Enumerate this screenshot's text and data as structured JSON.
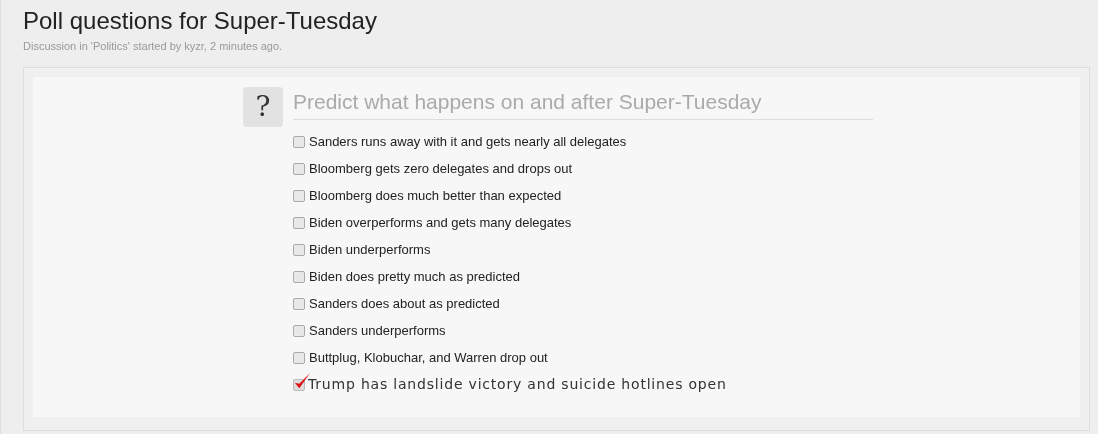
{
  "thread": {
    "title": "Poll questions for Super-Tuesday",
    "meta": "Discussion in 'Politics' started by kyzr, 2 minutes ago."
  },
  "poll": {
    "icon": "?",
    "question": "Predict what happens on and after Super-Tuesday",
    "options": [
      {
        "label": "Sanders runs away with it and gets nearly all delegates",
        "checked": false
      },
      {
        "label": "Bloomberg gets zero delegates and drops out",
        "checked": false
      },
      {
        "label": "Bloomberg does much better than expected",
        "checked": false
      },
      {
        "label": "Biden overperforms and gets many delegates",
        "checked": false
      },
      {
        "label": "Biden underperforms",
        "checked": false
      },
      {
        "label": "Biden does pretty much as predicted",
        "checked": false
      },
      {
        "label": "Sanders does about as predicted",
        "checked": false
      },
      {
        "label": "Sanders underperforms",
        "checked": false
      },
      {
        "label": "Buttplug, Klobuchar, and Warren drop out",
        "checked": false
      },
      {
        "label": "Trump has landslide victory and suicide hotlines open",
        "checked": true
      }
    ]
  }
}
